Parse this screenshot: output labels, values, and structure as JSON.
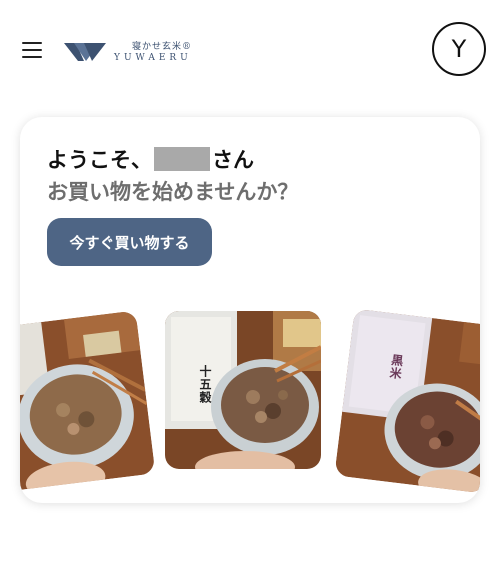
{
  "header": {
    "menu_icon": "hamburger-menu-icon",
    "logo": {
      "icon": "yuwaeru-logo-icon",
      "text_jp": "寝かせ玄米®",
      "text_en": "YUWAERU"
    },
    "avatar_initial": "Y"
  },
  "welcome": {
    "greeting_prefix": "ようこそ、",
    "greeting_suffix": "さん",
    "subtitle": "お買い物を始めませんか？",
    "button_label": "今すぐ買い物する"
  },
  "carousel": {
    "products": [
      {
        "name": "product-card-left"
      },
      {
        "name": "product-card-center",
        "label": "十五穀"
      },
      {
        "name": "product-card-right",
        "label": "黒米"
      }
    ]
  },
  "colors": {
    "brand_navy": "#3d5271",
    "button_bg": "#4e6585",
    "subtitle_gray": "#6e6e6e",
    "name_mask_gray": "#a9a9a9"
  }
}
